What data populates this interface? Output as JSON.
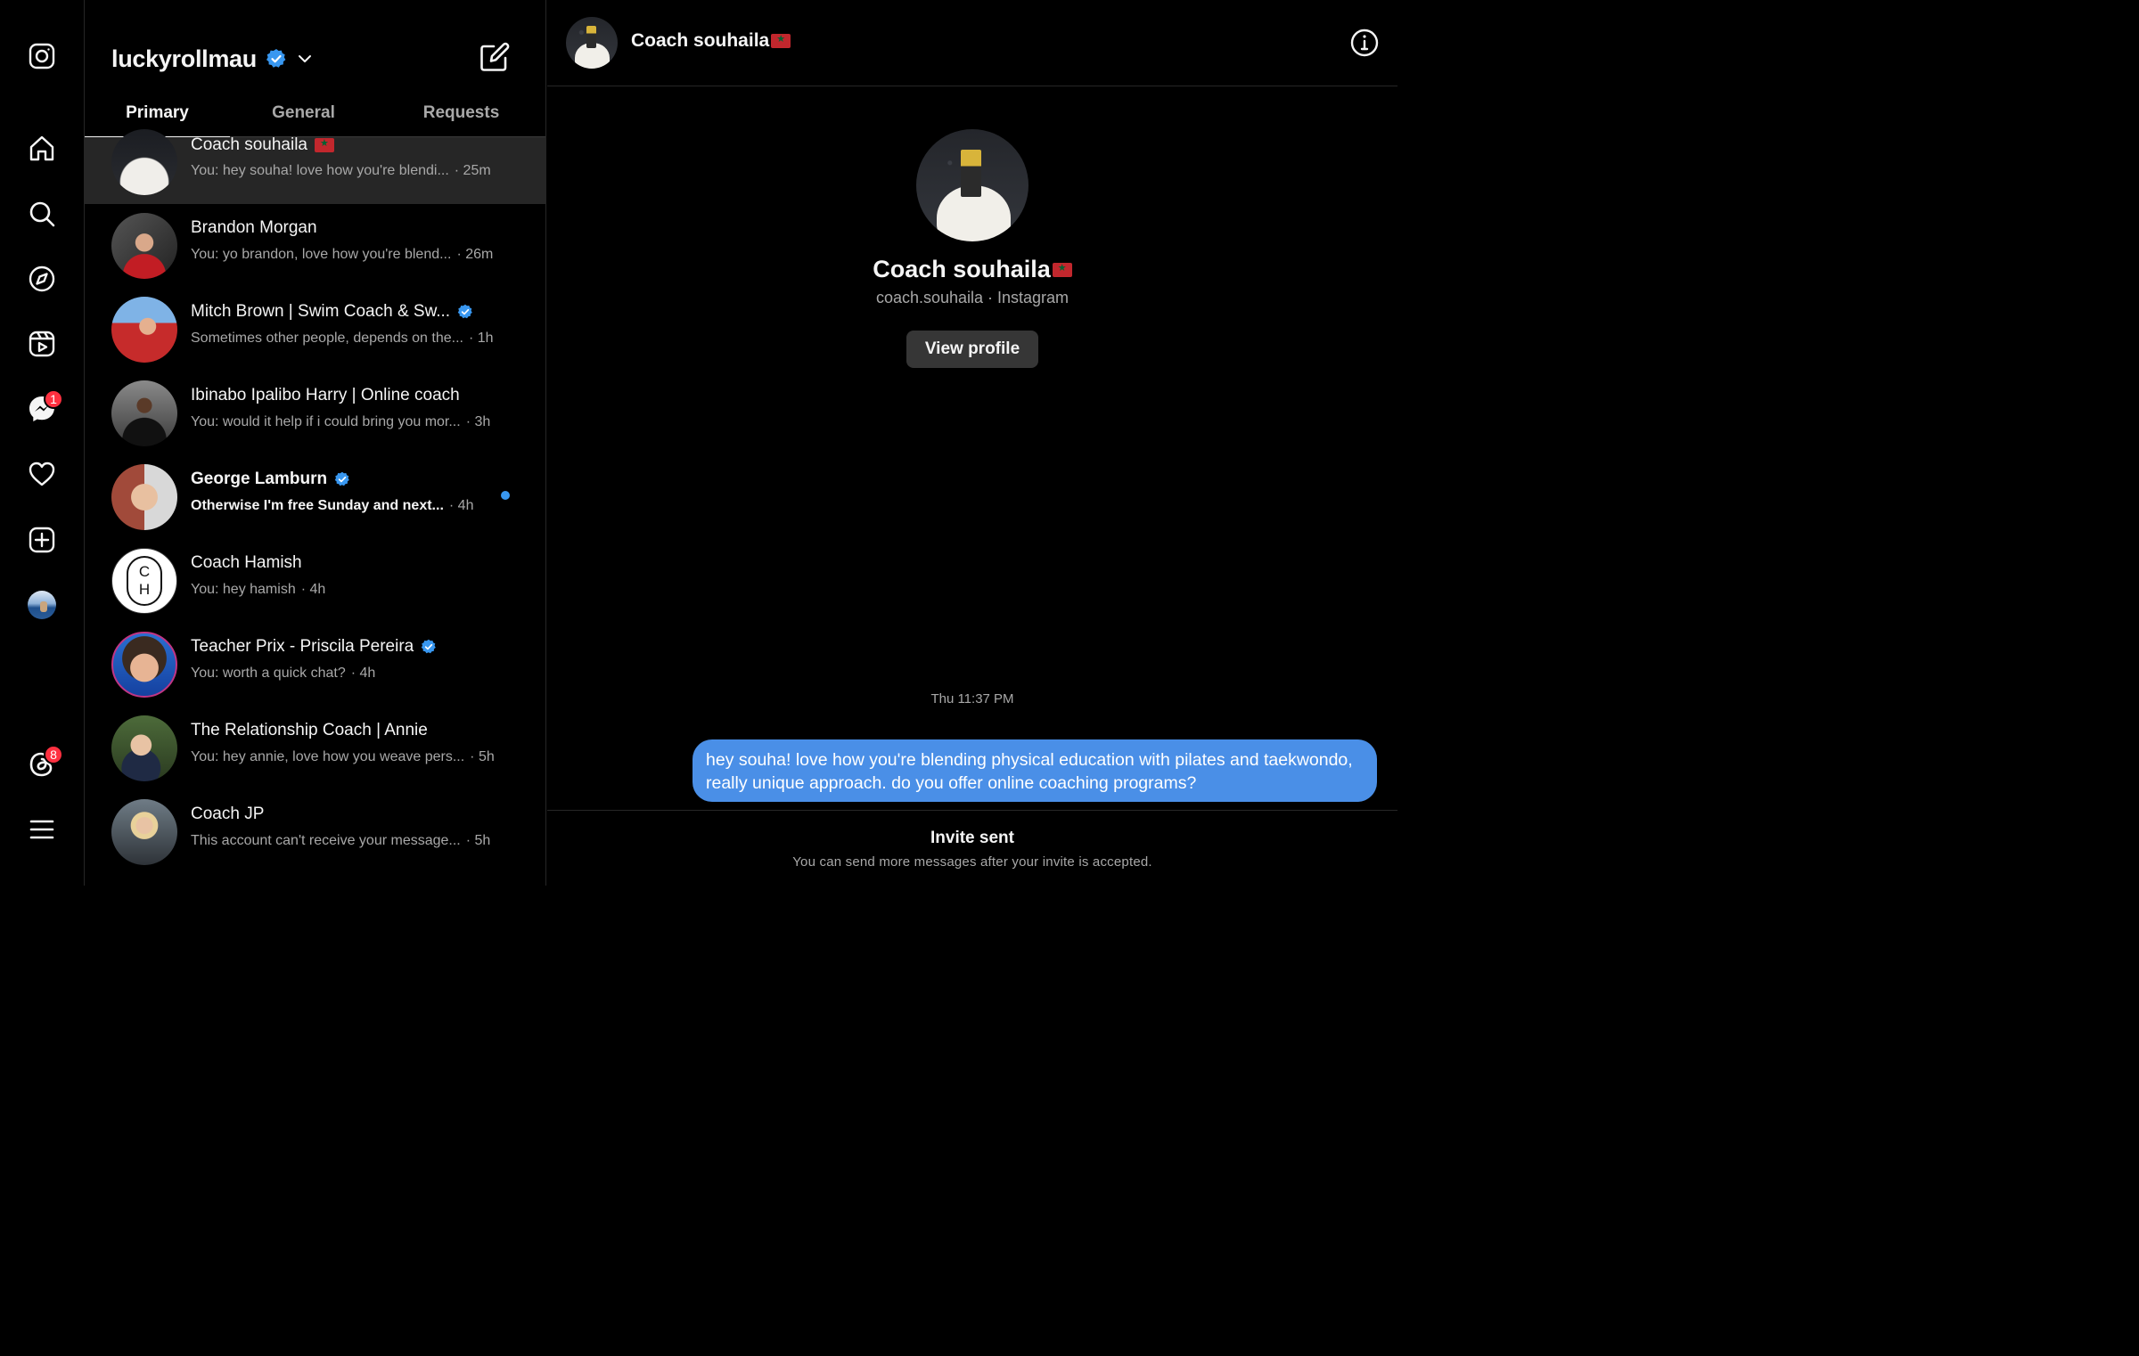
{
  "rail": {
    "items": [
      {
        "name": "instagram-logo-icon"
      },
      {
        "name": "home-icon"
      },
      {
        "name": "search-icon"
      },
      {
        "name": "explore-icon"
      },
      {
        "name": "reels-icon"
      },
      {
        "name": "messages-icon",
        "badge": "1"
      },
      {
        "name": "notifications-heart-icon"
      },
      {
        "name": "create-icon"
      },
      {
        "name": "profile-avatar"
      },
      {
        "name": "threads-icon",
        "badge": "8"
      },
      {
        "name": "menu-icon"
      }
    ]
  },
  "inbox": {
    "username": "luckyrollmau",
    "tabs": [
      "Primary",
      "General",
      "Requests"
    ],
    "active_tab": "Primary",
    "threads": [
      {
        "name": "Coach souhaila",
        "flag": true,
        "verified": false,
        "preview": "You: hey souha! love how you're blendi...",
        "time": "· 25m",
        "selected": true,
        "unread": false
      },
      {
        "name": "Brandon Morgan",
        "verified": false,
        "preview": "You: yo brandon, love how you're blend...",
        "time": "· 26m",
        "unread": false
      },
      {
        "name": "Mitch Brown | Swim Coach & Sw...",
        "verified": true,
        "preview": "Sometimes other people, depends on the...",
        "time": "· 1h",
        "unread": false
      },
      {
        "name": "Ibinabo Ipalibo Harry | Online coach",
        "verified": false,
        "preview": "You: would it help if i could bring you mor...",
        "time": "· 3h",
        "unread": false
      },
      {
        "name": "George Lamburn",
        "verified": true,
        "preview": "Otherwise I'm free Sunday and next...",
        "time": "· 4h",
        "unread": true
      },
      {
        "name": "Coach Hamish",
        "verified": false,
        "preview": "You: hey hamish",
        "time": "· 4h",
        "unread": false,
        "avatar_text": [
          "C",
          "H"
        ]
      },
      {
        "name": "Teacher Prix - Priscila Pereira",
        "verified": true,
        "preview": "You: worth a quick chat?",
        "time": "· 4h",
        "unread": false
      },
      {
        "name": "The Relationship Coach | Annie",
        "verified": false,
        "preview": "You: hey annie, love how you weave pers...",
        "time": "· 5h",
        "unread": false
      },
      {
        "name": "Coach JP",
        "verified": false,
        "preview": "This account can't receive your message...",
        "time": "· 5h",
        "unread": false
      }
    ]
  },
  "chat": {
    "header_name": "Coach souhaila",
    "profile_name": "Coach souhaila",
    "profile_sub": "coach.souhaila · Instagram",
    "view_profile_label": "View profile",
    "timestamp": "Thu 11:37 PM",
    "message": "hey souha! love how you're blending physical education with pilates and taekwondo, really unique approach. do you offer online coaching programs?",
    "invite_title": "Invite sent",
    "invite_sub": "You can send more messages after your invite is accepted."
  },
  "colors": {
    "background": "#000000",
    "selected_row": "#262626",
    "bubble": "#4a8fe7",
    "verified": "#3897f0",
    "badge": "#ff3040",
    "muted_text": "#a8a8a8"
  }
}
